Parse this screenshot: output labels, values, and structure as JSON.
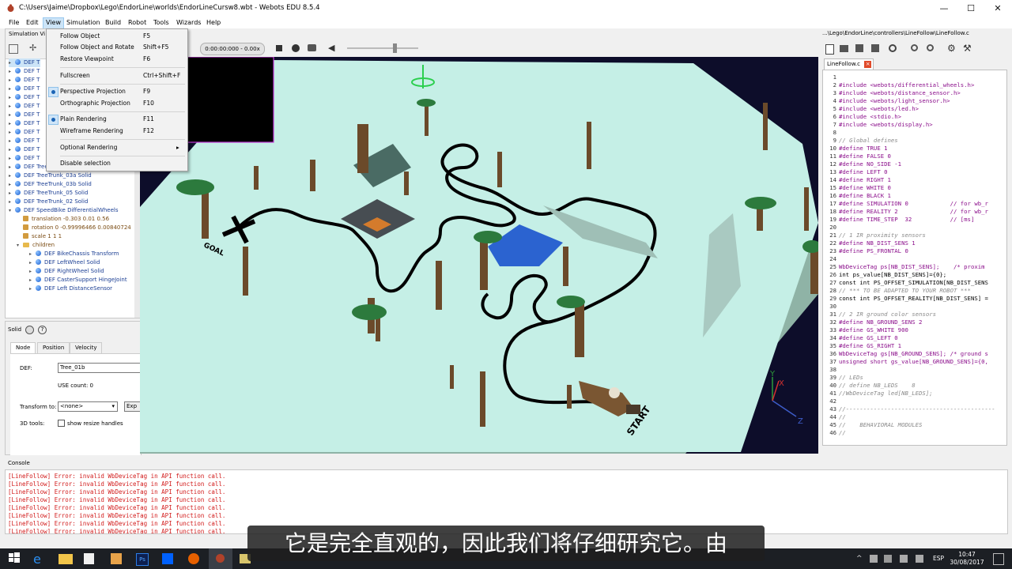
{
  "window": {
    "path": "C:\\Users\\Jaime\\Dropbox\\Lego\\EndorLine\\worlds\\EndorLineCursw8.wbt",
    "separator": " - ",
    "app": "Webots EDU 8.5.4",
    "min": "—",
    "max": "☐",
    "close": "✕"
  },
  "menubar": [
    "File",
    "Edit",
    "View",
    "Simulation",
    "Build",
    "Robot",
    "Tools",
    "Wizards",
    "Help"
  ],
  "view_menu": {
    "follow_object": {
      "label": "Follow Object",
      "shortcut": "F5"
    },
    "follow_rotate": {
      "label": "Follow Object and Rotate",
      "shortcut": "Shift+F5"
    },
    "restore_viewpoint": {
      "label": "Restore Viewpoint",
      "shortcut": "F6"
    },
    "fullscreen": {
      "label": "Fullscreen",
      "shortcut": "Ctrl+Shift+F"
    },
    "perspective": {
      "label": "Perspective Projection",
      "shortcut": "F9"
    },
    "orthographic": {
      "label": "Orthographic Projection",
      "shortcut": "F10"
    },
    "plain": {
      "label": "Plain Rendering",
      "shortcut": "F11"
    },
    "wireframe": {
      "label": "Wireframe Rendering",
      "shortcut": "F12"
    },
    "optional": {
      "label": "Optional Rendering",
      "arrow": "▸"
    },
    "disable_selection": {
      "label": "Disable selection"
    }
  },
  "scene_tree": {
    "header": "Simulation Vi",
    "items": [
      {
        "text": "DEF T",
        "y": 0
      },
      {
        "text": "DEF T",
        "y": 1
      },
      {
        "text": "DEF T",
        "y": 2
      },
      {
        "text": "DEF T",
        "y": 3
      },
      {
        "text": "DEF T",
        "y": 4
      },
      {
        "text": "DEF T",
        "y": 5
      },
      {
        "text": "DEF T",
        "y": 6
      },
      {
        "text": "DEF T",
        "y": 7
      },
      {
        "text": "DEF T",
        "y": 8
      },
      {
        "text": "DEF T",
        "y": 9
      },
      {
        "text": "DEF T",
        "y": 10
      },
      {
        "text": "DEF T",
        "y": 11
      }
    ],
    "named_items": [
      "DEF TreeTrunk_01d Solid",
      "DEF TreeTrunk_03a Solid",
      "DEF TreeTrunk_03b Solid",
      "DEF TreeTrunk_05 Solid",
      "DEF TreeTrunk_02 Solid",
      "DEF SpeedBike DifferentialWheels"
    ],
    "fields": [
      "translation -0.303 0.01 0.56",
      "rotation 0 -0.99996466 0.00840724",
      "scale 1 1 1"
    ],
    "children_label": "children",
    "children": [
      "DEF BikeChassis Transform",
      "DEF LeftWheel Solid",
      "DEF RightWheel Solid",
      "DEF CasterSupport HingeJoint",
      "DEF Left DistanceSensor"
    ]
  },
  "field_editor": {
    "type": "Solid",
    "tabs": [
      "Node",
      "Position",
      "Velocity"
    ],
    "def_label": "DEF:",
    "def_value": "Tree_01b",
    "use_count": "USE count: 0",
    "transform_label": "Transform to:",
    "transform_value": "<none>",
    "export": "Exp",
    "tools_label": "3D tools:",
    "resize": "show resize handles"
  },
  "toolbar3d": {
    "time": "0:00:00:000",
    "speed": "- 0.00x"
  },
  "scene_labels": {
    "goal": "GOAL",
    "start": "START",
    "x": "X",
    "y": "Y",
    "z": "Z"
  },
  "editor": {
    "path": "...\\Lego\\EndorLine\\controllers\\LineFollow\\LineFollow.c",
    "tab": "LineFollow.c",
    "lines": [
      {
        "n": "1",
        "t": ""
      },
      {
        "n": "2",
        "t": "#include <webots/differential_wheels.h>",
        "c": "kw"
      },
      {
        "n": "3",
        "t": "#include <webots/distance_sensor.h>",
        "c": "kw"
      },
      {
        "n": "4",
        "t": "#include <webots/light_sensor.h>",
        "c": "kw"
      },
      {
        "n": "5",
        "t": "#include <webots/led.h>",
        "c": "kw"
      },
      {
        "n": "6",
        "t": "#include <stdio.h>",
        "c": "kw"
      },
      {
        "n": "7",
        "t": "#include <webots/display.h>",
        "c": "kw"
      },
      {
        "n": "8",
        "t": ""
      },
      {
        "n": "9",
        "t": "// Global defines",
        "c": "cm"
      },
      {
        "n": "10",
        "t": "#define TRUE 1",
        "c": "kw"
      },
      {
        "n": "11",
        "t": "#define FALSE 0",
        "c": "kw"
      },
      {
        "n": "12",
        "t": "#define NO_SIDE -1",
        "c": "kw"
      },
      {
        "n": "13",
        "t": "#define LEFT 0",
        "c": "kw"
      },
      {
        "n": "14",
        "t": "#define RIGHT 1",
        "c": "kw"
      },
      {
        "n": "15",
        "t": "#define WHITE 0",
        "c": "kw"
      },
      {
        "n": "16",
        "t": "#define BLACK 1",
        "c": "kw"
      },
      {
        "n": "17",
        "t": "#define SIMULATION 0            // for wb_r",
        "c": "kw"
      },
      {
        "n": "18",
        "t": "#define REALITY 2               // for wb_r",
        "c": "kw"
      },
      {
        "n": "19",
        "t": "#define TIME_STEP  32           // [ms]",
        "c": "kw"
      },
      {
        "n": "20",
        "t": ""
      },
      {
        "n": "21",
        "t": "// 1 IR proximity sensors",
        "c": "cm"
      },
      {
        "n": "22",
        "t": "#define NB_DIST_SENS 1",
        "c": "kw"
      },
      {
        "n": "23",
        "t": "#define PS_FRONTAL 0",
        "c": "kw"
      },
      {
        "n": "24",
        "t": ""
      },
      {
        "n": "25",
        "t": "WbDeviceTag ps[NB_DIST_SENS];    /* proxim",
        "c": "kw"
      },
      {
        "n": "26",
        "t": "int ps_value[NB_DIST_SENS]={0};",
        "c": "co"
      },
      {
        "n": "27",
        "t": "const int PS_OFFSET_SIMULATION[NB_DIST_SENS",
        "c": "co"
      },
      {
        "n": "28",
        "t": "// *** TO BE ADAPTED TO YOUR ROBOT ***",
        "c": "cm"
      },
      {
        "n": "29",
        "t": "const int PS_OFFSET_REALITY[NB_DIST_SENS] =",
        "c": "co"
      },
      {
        "n": "30",
        "t": ""
      },
      {
        "n": "31",
        "t": "// 2 IR ground color sensors",
        "c": "cm"
      },
      {
        "n": "32",
        "t": "#define NB_GROUND_SENS 2",
        "c": "kw"
      },
      {
        "n": "33",
        "t": "#define GS_WHITE 900",
        "c": "kw"
      },
      {
        "n": "34",
        "t": "#define GS_LEFT 0",
        "c": "kw"
      },
      {
        "n": "35",
        "t": "#define GS_RIGHT 1",
        "c": "kw"
      },
      {
        "n": "36",
        "t": "WbDeviceTag gs[NB_GROUND_SENS]; /* ground s",
        "c": "kw"
      },
      {
        "n": "37",
        "t": "unsigned short gs_value[NB_GROUND_SENS]={0,",
        "c": "kw"
      },
      {
        "n": "38",
        "t": ""
      },
      {
        "n": "39",
        "t": "// LEDs",
        "c": "cm"
      },
      {
        "n": "40",
        "t": "// define NB_LEDS    8",
        "c": "cm"
      },
      {
        "n": "41",
        "t": "//WbDeviceTag led[NB_LEDS];",
        "c": "cm"
      },
      {
        "n": "42",
        "t": ""
      },
      {
        "n": "43",
        "t": "//-------------------------------------------",
        "c": "cm"
      },
      {
        "n": "44",
        "t": "//",
        "c": "cm"
      },
      {
        "n": "45",
        "t": "//    BEHAVIORAL MODULES",
        "c": "cm"
      },
      {
        "n": "46",
        "t": "//",
        "c": "cm"
      }
    ]
  },
  "console": {
    "header": "Console",
    "lines": [
      "[LineFollow] Error: invalid WbDeviceTag in API function call.",
      "[LineFollow] Error: invalid WbDeviceTag in API function call.",
      "[LineFollow] Error: invalid WbDeviceTag in API function call.",
      "[LineFollow] Error: invalid WbDeviceTag in API function call.",
      "[LineFollow] Error: invalid WbDeviceTag in API function call.",
      "[LineFollow] Error: invalid WbDeviceTag in API function call.",
      "[LineFollow] Error: invalid WbDeviceTag in API function call.",
      "[LineFollow] Error: invalid WbDeviceTag in API function call."
    ]
  },
  "subtitle": "它是完全直观的，因此我们将仔细研究它。由",
  "taskbar": {
    "lang": "ESP",
    "time": "10:47",
    "date": "30/08/2017",
    "ps_label": "Ps"
  },
  "colors": {
    "accent": "#0078d7",
    "error": "#d21b1b",
    "floor": "#c5efe6",
    "sky": "#0d0d2a"
  }
}
